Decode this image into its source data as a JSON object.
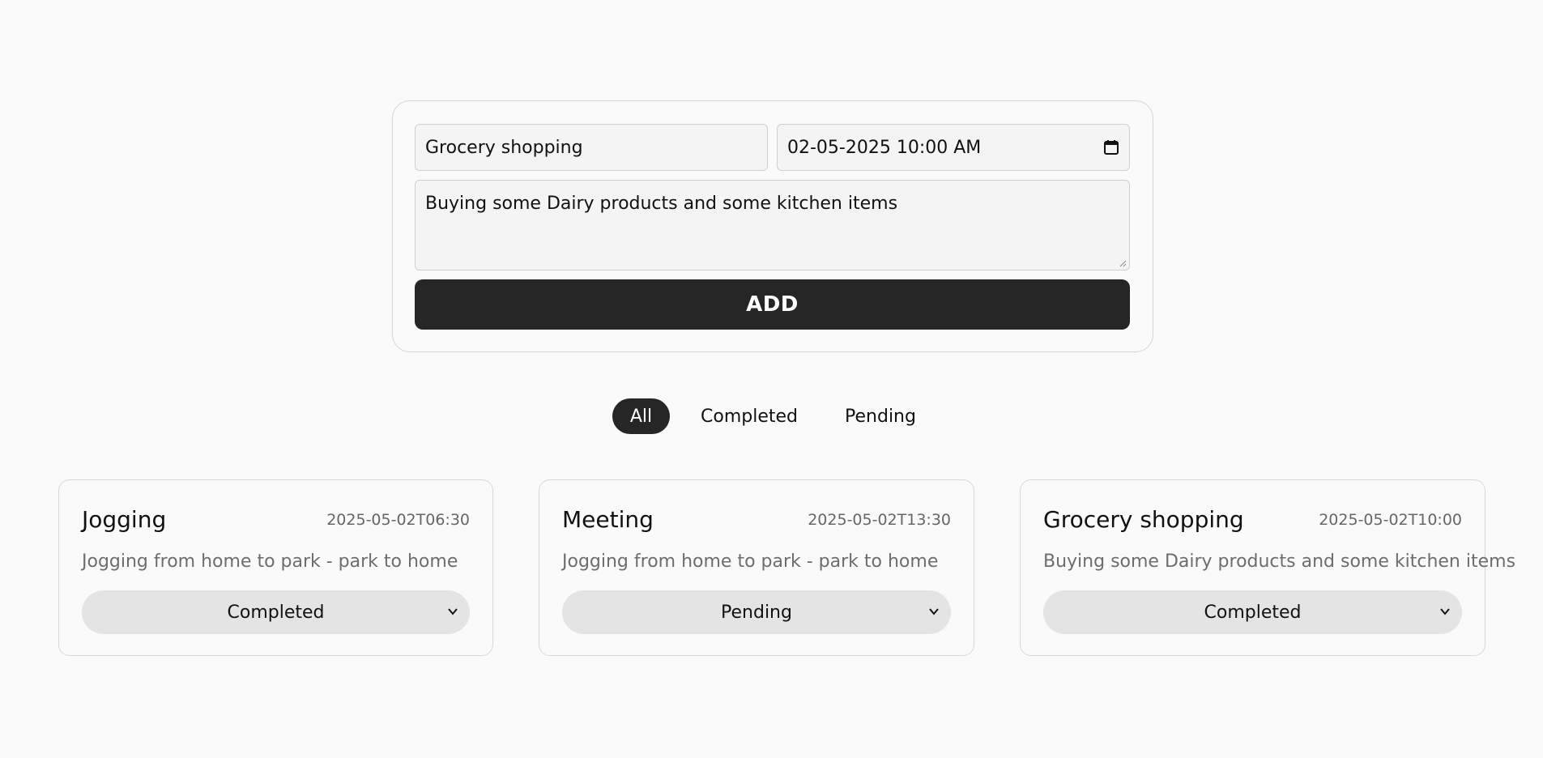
{
  "form": {
    "title_value": "Grocery shopping",
    "datetime_value": "02-05-2025 10:00 AM",
    "datetime_icon": "calendar-icon",
    "description_value": "Buying some Dairy products and some kitchen items",
    "add_label": "ADD"
  },
  "filters": {
    "tabs": [
      {
        "label": "All",
        "active": true
      },
      {
        "label": "Completed",
        "active": false
      },
      {
        "label": "Pending",
        "active": false
      }
    ]
  },
  "tasks": [
    {
      "title": "Jogging",
      "date": "2025-05-02T06:30",
      "description": "Jogging from home to park - park to home",
      "status": "Completed"
    },
    {
      "title": "Meeting",
      "date": "2025-05-02T13:30",
      "description": "Jogging from home to park - park to home",
      "status": "Pending"
    },
    {
      "title": "Grocery shopping",
      "date": "2025-05-02T10:00",
      "description": "Buying some Dairy products and some kitchen items",
      "status": "Completed"
    }
  ],
  "colors": {
    "background": "#fafafa",
    "accent": "#262626",
    "select_bg": "#e4e4e4"
  }
}
